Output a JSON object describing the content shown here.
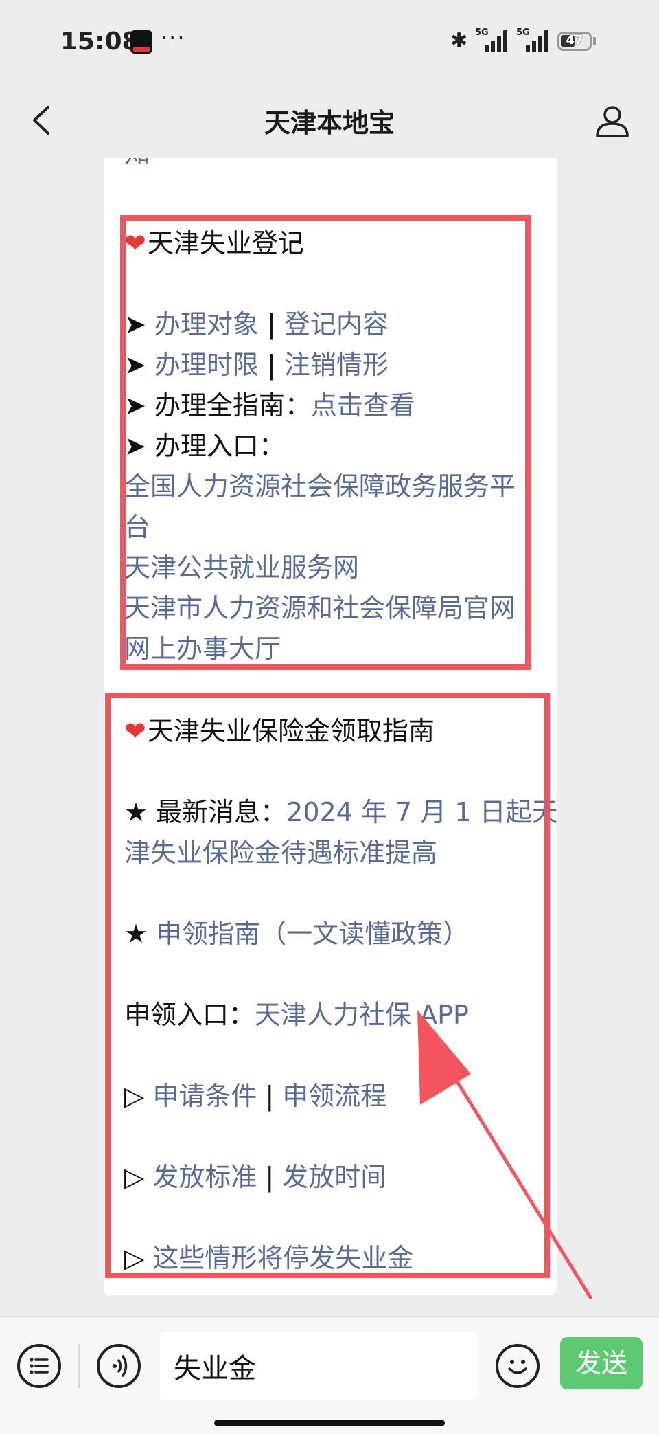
{
  "status": {
    "time": "15:08",
    "more": "···",
    "signal1": "5G",
    "signal2": "5G",
    "battery": "47"
  },
  "nav": {
    "title": "天津本地宝"
  },
  "article": {
    "partial_top": "知",
    "section1": {
      "heading": "天津失业登记",
      "row1": {
        "bullet": "➤ ",
        "link1": "办理对象",
        "sep": " | ",
        "link2": "登记内容"
      },
      "row2": {
        "bullet": "➤ ",
        "link1": "办理时限",
        "sep": " | ",
        "link2": "注销情形"
      },
      "row3": {
        "label": "➤ 办理全指南：",
        "link": "点击查看"
      },
      "row4": {
        "label": "➤ 办理入口："
      },
      "links": [
        "全国人力资源社会保障政务服务平",
        "台",
        "天津公共就业服务网",
        "天津市人力资源和社会保障局官网",
        "网上办事大厅"
      ]
    },
    "section2": {
      "heading": "天津失业保险金领取指南",
      "news_label": "★ 最新消息：",
      "news_link_line1": "2024 年 7 月 1 日起天",
      "news_link_line2": "津失业保险金待遇标准提高",
      "guide_bullet": "★ ",
      "guide_link": "申领指南（一文读懂政策）",
      "entry_label": "申领入口：",
      "entry_link": "天津人力社保 APP",
      "row_a": {
        "bullet": "▷ ",
        "link1": "申请条件",
        "sep": " | ",
        "link2": "申领流程"
      },
      "row_b": {
        "bullet": "▷ ",
        "link1": "发放标准",
        "sep": " | ",
        "link2": "发放时间"
      },
      "row_c": {
        "bullet": "▷ ",
        "link1": "这些情形将停发失业金"
      }
    }
  },
  "input": {
    "value": "失业金",
    "send_label": "发送"
  },
  "colors": {
    "link": "#576b95",
    "highlight_box": "#f4545e",
    "send_button": "#5dc973"
  }
}
